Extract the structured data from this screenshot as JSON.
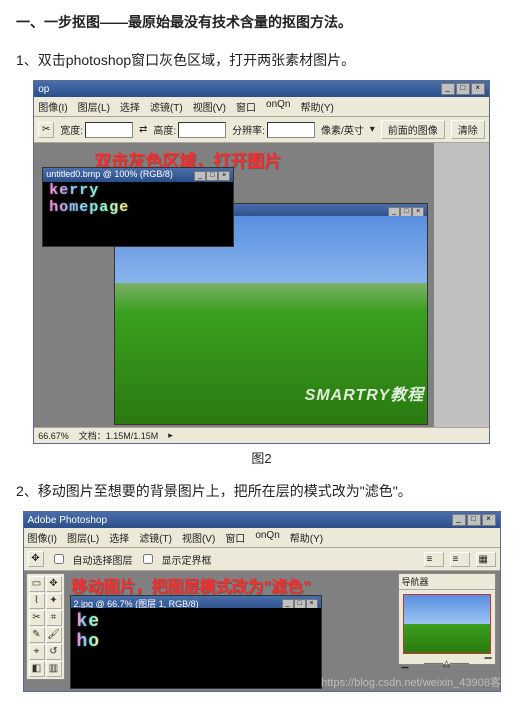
{
  "heading": "一、一步抠图——最原始最没有技术含量的抠图方法。",
  "step1": "1、双击photoshop窗口灰色区域，打开两张素材图片。",
  "step2": "2、移动图片至想要的背景图片上，把所在层的模式改为\"滤色\"。",
  "caption1": "图2",
  "fig1": {
    "app_title": "op",
    "menus": [
      "图像(I)",
      "图层(L)",
      "选择",
      "滤镜(T)",
      "视图(V)",
      "窗口",
      "onQn",
      "帮助(Y)"
    ],
    "opt_labels": {
      "width": "宽度:",
      "height": "高度:",
      "unit": "像素/英寸",
      "front": "前面的图像",
      "clear": "清除"
    },
    "opt_label2": "分辨率:",
    "overlay": "双击灰色区域，打开图片",
    "doc1_title": "untitled0.bmp @ 100% (RGB/8)",
    "neon_line1": "kerry",
    "neon_line2": "homepage",
    "zoom": "66.67%",
    "status": "文档：1.15M/1.15M",
    "watermark": "SMARTRY教程"
  },
  "fig2": {
    "app_title": "Adobe Photoshop",
    "menus": [
      "图像(I)",
      "图层(L)",
      "选择",
      "滤镜(T)",
      "视图(V)",
      "窗口",
      "onQn",
      "帮助(Y)"
    ],
    "opt_cb1": "自动选择图层",
    "opt_cb2": "显示定界框",
    "overlay": "移动图片，把图层模式改为\"滤色\"",
    "doc_title": "2.jpg @ 66.7% (图层 1, RGB/8)",
    "neon_line1": "ke",
    "neon_line2": "ho",
    "palette_title": "导航器"
  },
  "csdn": "https://blog.csdn.net/weixin_43908客"
}
